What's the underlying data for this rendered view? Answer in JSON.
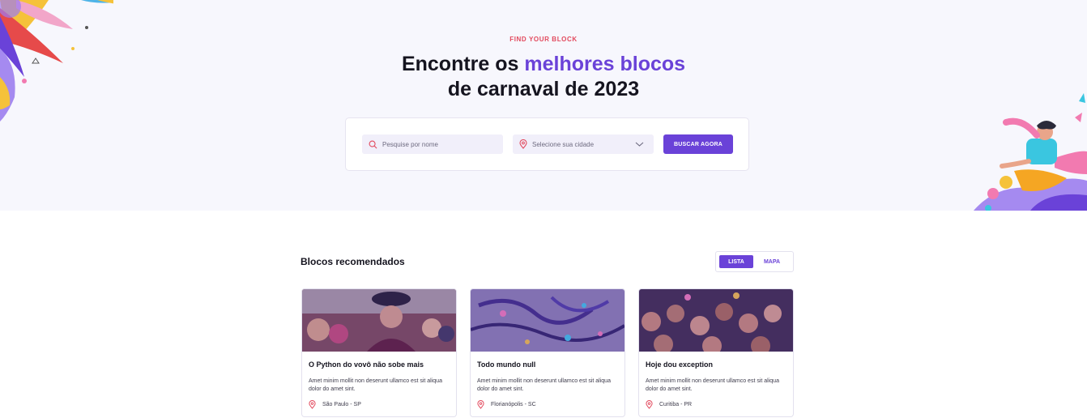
{
  "hero": {
    "eyebrow": "FIND YOUR BLOCK",
    "headline_part1": "Encontre os ",
    "headline_accent": "melhores blocos",
    "headline_part2": "de carnaval de 2023"
  },
  "search": {
    "name_placeholder": "Pesquise por nome",
    "city_placeholder": "Selecione sua cidade",
    "button_label": "BUSCAR AGORA"
  },
  "section": {
    "title": "Blocos recomendados",
    "view_toggle": [
      {
        "label": "LISTA",
        "active": true
      },
      {
        "label": "MAPA",
        "active": false
      }
    ]
  },
  "cards": [
    {
      "title": "O Python do vovô não sobe mais",
      "description": "Amet minim mollit non deserunt ullamco est sit aliqua dolor do amet sint.",
      "location": "São Paulo - SP"
    },
    {
      "title": "Todo mundo null",
      "description": "Amet minim mollit non deserunt ullamco est sit aliqua dolor do amet sint.",
      "location": "Florianópolis - SC"
    },
    {
      "title": "Hoje dou exception",
      "description": "Amet minim mollit non deserunt ullamco est sit aliqua dolor do amet sint.",
      "location": "Curitiba - PR"
    }
  ],
  "colors": {
    "accent": "#6a42d8",
    "eyebrow": "#e2495d",
    "hero_bg": "#f7f7fd",
    "field_bg": "#f1effa"
  },
  "icons": {
    "search": "search-icon",
    "city": "map-pin-icon",
    "dropdown": "chevron-down-icon",
    "location": "map-pin-icon"
  }
}
